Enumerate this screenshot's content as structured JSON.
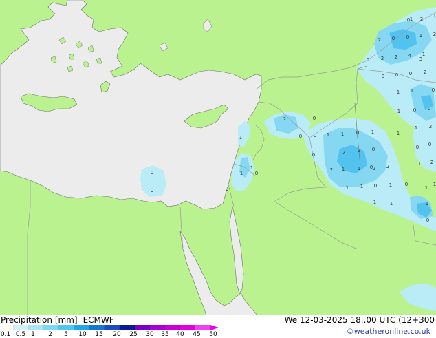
{
  "title": {
    "product": "Precipitation [mm]",
    "model": "ECMWF"
  },
  "valid_time": "We 12-03-2025 18..00 UTC (12+300",
  "credit": "©weatheronline.co.uk",
  "legend": {
    "labels": [
      "0.1",
      "0.5",
      "1",
      "2",
      "5",
      "10",
      "15",
      "20",
      "25",
      "30",
      "35",
      "40",
      "45",
      "50"
    ],
    "colors": [
      "#fcfcf0",
      "#d2f0fa",
      "#a6e6f8",
      "#7ad8f4",
      "#4ec8f0",
      "#1fa8e6",
      "#1478d2",
      "#1c4cc0",
      "#0a1a96",
      "#7a00c8",
      "#a800d8",
      "#c800d8",
      "#e000e0",
      "#f040f0"
    ]
  },
  "map": {
    "colors": {
      "land": "#b9f28e",
      "outside_domain": "#ececec",
      "sea": "#ececec",
      "borders": "#9a9a9a",
      "coast": "#6e6e6e",
      "light_precip": "#b9ecf6",
      "moderate_precip": "#86d8f2",
      "heavy_precip": "#52c2ee"
    },
    "values": [
      "0",
      "0",
      "0",
      "1",
      "1",
      "1",
      "0",
      "2",
      "0",
      "0",
      "0",
      "1",
      "1",
      "0",
      "1",
      "0",
      "2",
      "2",
      "0",
      "1",
      "1",
      "2",
      "2",
      "2",
      "1",
      "1",
      "0",
      "1",
      "0",
      "1",
      "0",
      "2",
      "2",
      "0",
      "0",
      "1",
      "2",
      "2",
      "2",
      "4",
      "1",
      "0",
      "0",
      "0",
      "0",
      "2",
      "1",
      "1",
      "1",
      "0",
      "0",
      "1",
      "2",
      "1",
      "0",
      "0",
      "1",
      "2",
      "1",
      "0",
      "3",
      "1",
      "0",
      "1",
      "1",
      "1",
      "0",
      "1"
    ]
  }
}
